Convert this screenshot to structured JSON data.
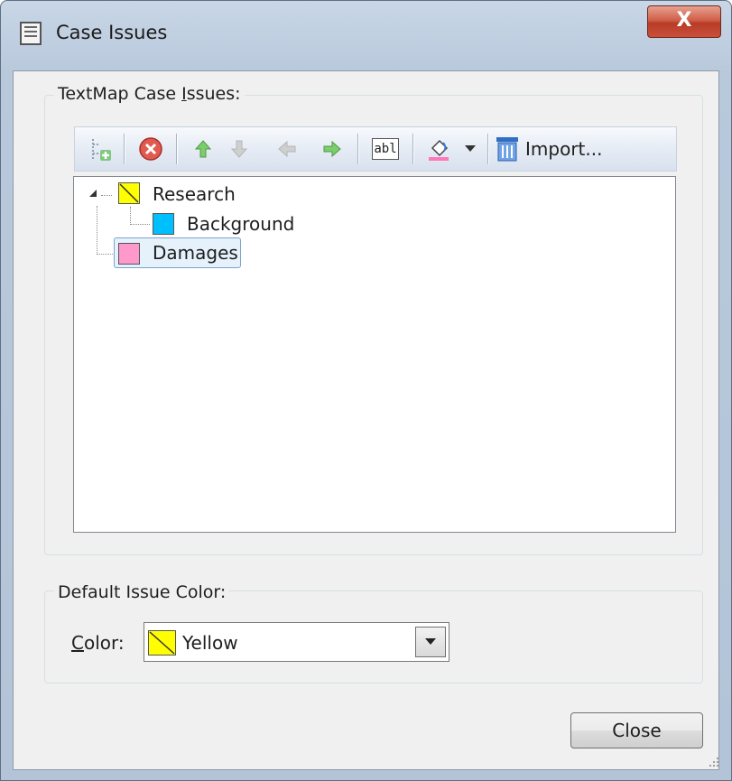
{
  "window": {
    "title": "Case Issues",
    "close_glyph": "X"
  },
  "issues_group": {
    "label_before": "TextMap Case ",
    "label_accel": "I",
    "label_after": "ssues:"
  },
  "toolbar": {
    "import_label": "Import...",
    "rename_glyph": "abl",
    "icons": [
      "add-issue-icon",
      "delete-icon",
      "move-up-icon",
      "move-down-icon",
      "move-left-icon",
      "move-right-icon",
      "rename-icon",
      "fill-color-icon",
      "dropdown-arrow-icon",
      "import-icon"
    ]
  },
  "tree": {
    "items": [
      {
        "label": "Research",
        "color": "#ffff00",
        "level": 0,
        "expanded": true,
        "swatch": "yellow-slash"
      },
      {
        "label": "Background",
        "color": "#00bfff",
        "level": 1
      },
      {
        "label": "Damages",
        "color": "#ff99cc",
        "level": 0,
        "selected": true
      }
    ]
  },
  "default_group": {
    "label": "Default Issue Color:",
    "color_label_accel": "C",
    "color_label_rest": "olor:",
    "selected_value": "Yellow",
    "selected_color": "#ffff00"
  },
  "footer": {
    "close_label": "Close"
  }
}
